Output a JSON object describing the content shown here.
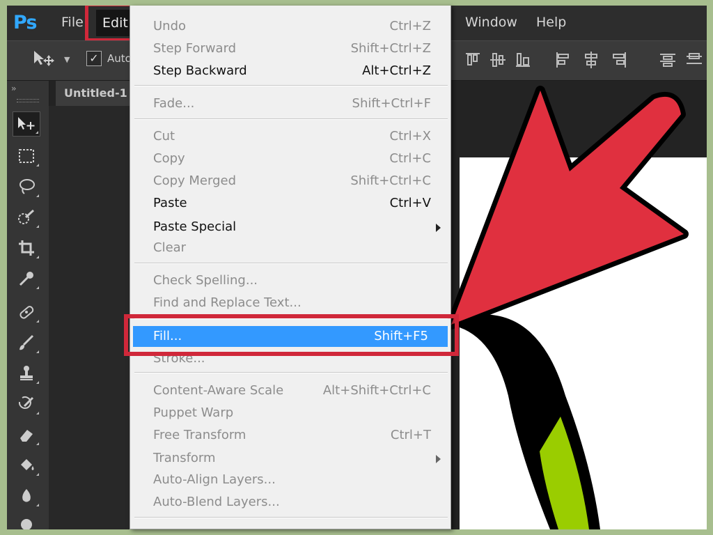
{
  "app": {
    "logo": "Ps",
    "document_tab": "Untitled-1 @"
  },
  "menubar": {
    "items": [
      "File",
      "Edit",
      "Window",
      "Help"
    ],
    "active": "Edit"
  },
  "options_bar": {
    "auto_select_label": "Auto-",
    "auto_select_checked": true
  },
  "edit_menu": {
    "items": [
      {
        "label": "Undo",
        "shortcut": "Ctrl+Z",
        "enabled": false
      },
      {
        "label": "Step Forward",
        "shortcut": "Shift+Ctrl+Z",
        "enabled": false
      },
      {
        "label": "Step Backward",
        "shortcut": "Alt+Ctrl+Z",
        "enabled": true
      },
      {
        "label": "Fade...",
        "shortcut": "Shift+Ctrl+F",
        "enabled": false
      },
      {
        "label": "Cut",
        "shortcut": "Ctrl+X",
        "enabled": false
      },
      {
        "label": "Copy",
        "shortcut": "Ctrl+C",
        "enabled": false
      },
      {
        "label": "Copy Merged",
        "shortcut": "Shift+Ctrl+C",
        "enabled": false
      },
      {
        "label": "Paste",
        "shortcut": "Ctrl+V",
        "enabled": true
      },
      {
        "label": "Paste Special",
        "shortcut": "",
        "enabled": true,
        "submenu": true
      },
      {
        "label": "Clear",
        "shortcut": "",
        "enabled": false
      },
      {
        "label": "Check Spelling...",
        "shortcut": "",
        "enabled": false
      },
      {
        "label": "Find and Replace Text...",
        "shortcut": "",
        "enabled": false
      },
      {
        "label": "Fill...",
        "shortcut": "Shift+F5",
        "enabled": true,
        "highlighted": true
      },
      {
        "label": "Stroke...",
        "shortcut": "",
        "enabled": false
      },
      {
        "label": "Content-Aware Scale",
        "shortcut": "Alt+Shift+Ctrl+C",
        "enabled": false
      },
      {
        "label": "Puppet Warp",
        "shortcut": "",
        "enabled": false
      },
      {
        "label": "Free Transform",
        "shortcut": "Ctrl+T",
        "enabled": false
      },
      {
        "label": "Transform",
        "shortcut": "",
        "enabled": false,
        "submenu": true
      },
      {
        "label": "Auto-Align Layers...",
        "shortcut": "",
        "enabled": false
      },
      {
        "label": "Auto-Blend Layers...",
        "shortcut": "",
        "enabled": false
      }
    ]
  },
  "toolbox": {
    "tools": [
      "move-icon",
      "marquee-icon",
      "lasso-icon",
      "quick-selection-icon",
      "crop-icon",
      "eyedropper-icon",
      "healing-brush-icon",
      "brush-icon",
      "clone-stamp-icon",
      "history-brush-icon",
      "eraser-icon",
      "paint-bucket-icon",
      "blur-icon",
      "dodge-icon"
    ]
  },
  "colors": {
    "highlight_border": "#d0283a",
    "selected_item": "#3399ff",
    "annotation_arrow": "#e0303f",
    "background_frame": "#a7be8e",
    "artwork_green": "#9acd00"
  }
}
